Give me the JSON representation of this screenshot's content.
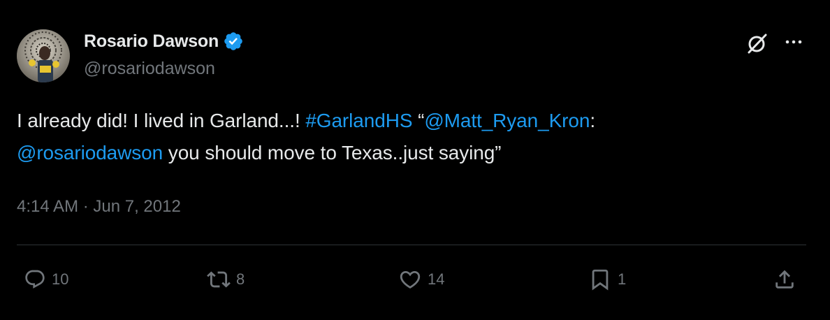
{
  "author": {
    "display_name": "Rosario Dawson",
    "handle": "@rosariodawson",
    "verified": true
  },
  "tweet": {
    "text_1": "I already did! I lived in Garland...! ",
    "hashtag": "#GarlandHS",
    "text_2": " “",
    "mention_1": "@Matt_Ryan_Kron",
    "text_3": ":",
    "mention_2": "@rosariodawson",
    "text_4": " you should move to Texas..just saying”"
  },
  "timestamp": "4:14 AM · Jun 7, 2012",
  "actions": {
    "reply_count": "10",
    "retweet_count": "8",
    "like_count": "14",
    "bookmark_count": "1"
  },
  "icons": {
    "verified": "verified-badge-icon",
    "grok": "grok-icon",
    "more": "more-icon",
    "reply": "reply-icon",
    "retweet": "retweet-icon",
    "like": "heart-icon",
    "bookmark": "bookmark-icon",
    "share": "share-icon"
  },
  "colors": {
    "background": "#000000",
    "text": "#e7e9ea",
    "muted": "#71767b",
    "link": "#1d9bf0",
    "divider": "#2f3336"
  }
}
